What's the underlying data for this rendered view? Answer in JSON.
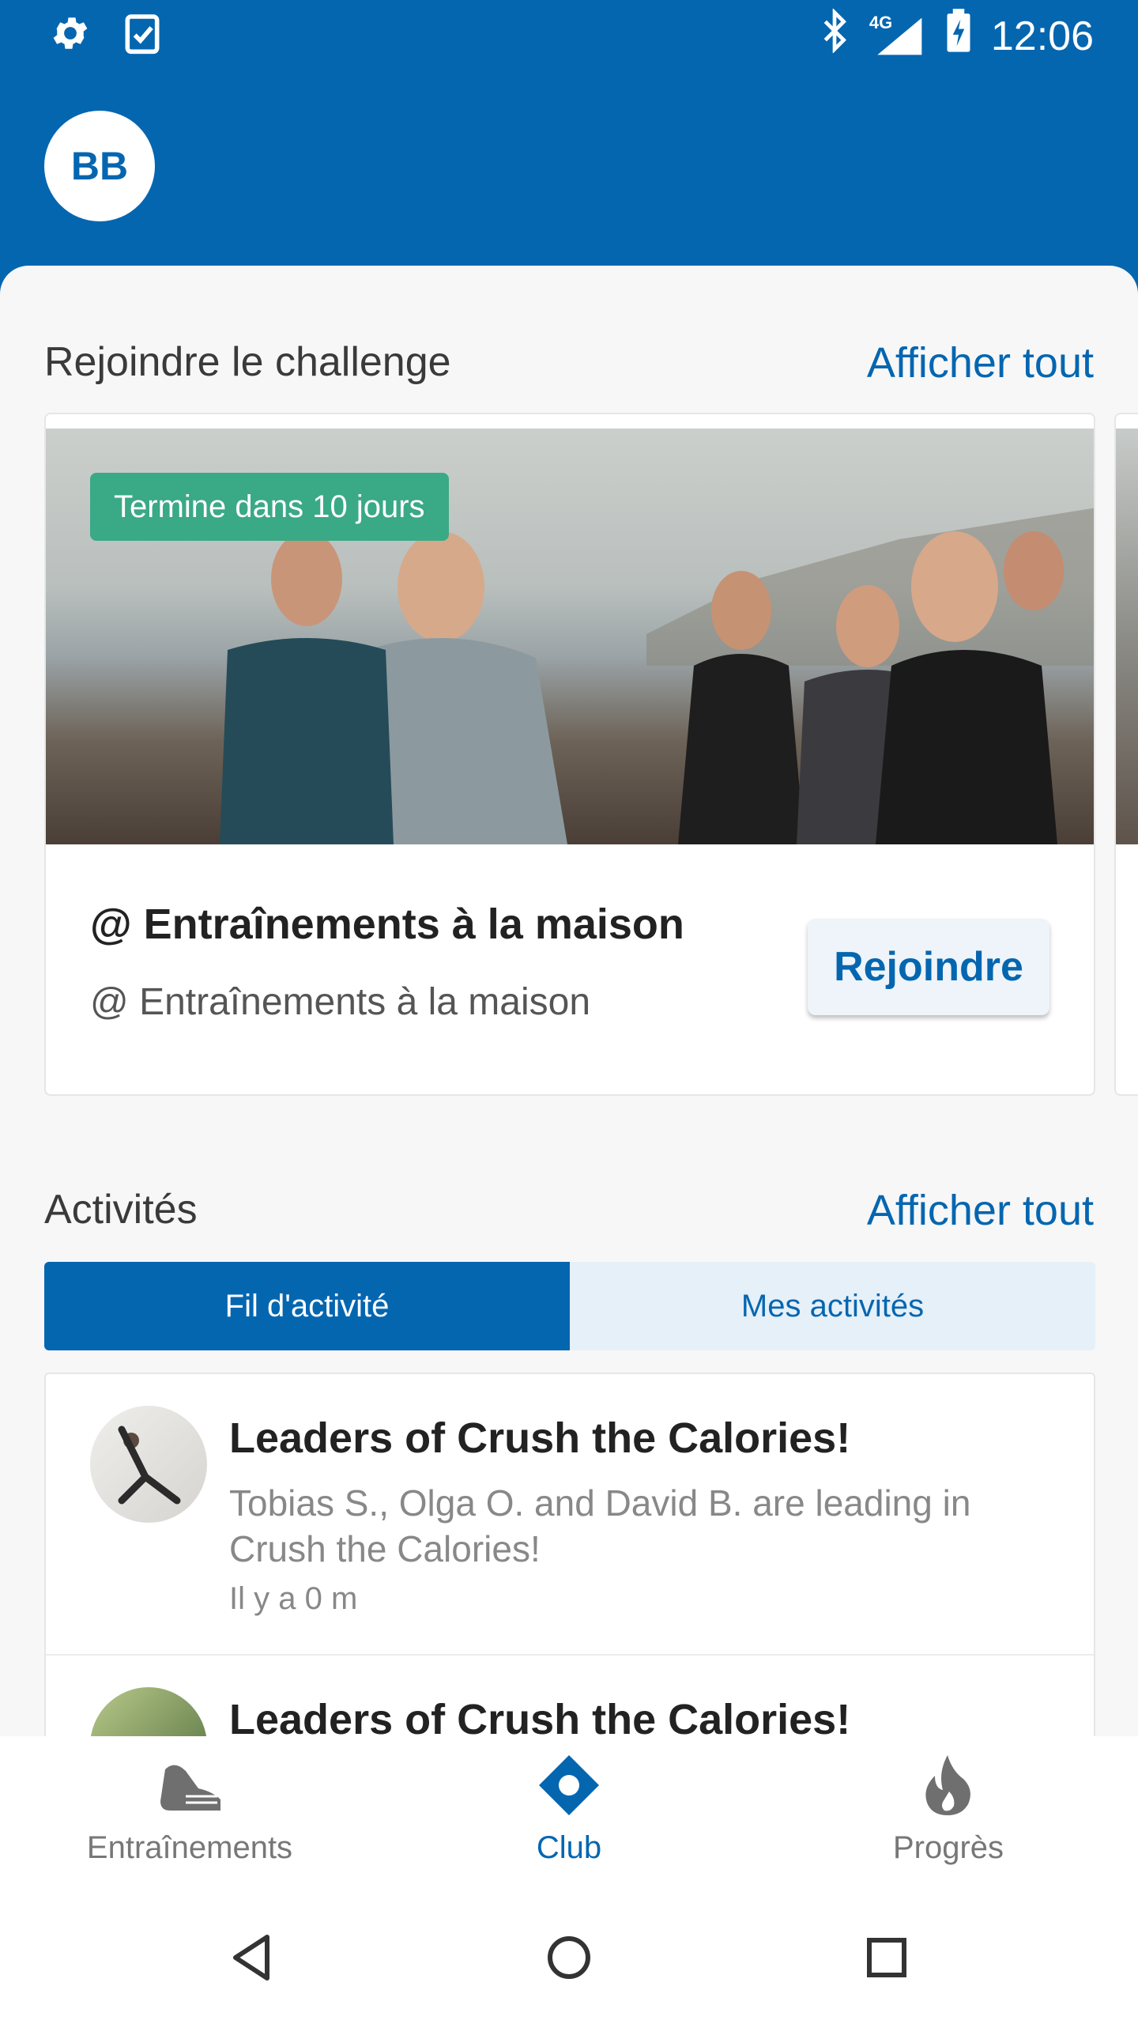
{
  "status_bar": {
    "time": "12:06",
    "network": "4G"
  },
  "header": {
    "avatar_initials": "BB"
  },
  "challenge_section": {
    "title": "Rejoindre le challenge",
    "see_all": "Afficher tout",
    "card": {
      "badge": "Termine dans 10 jours",
      "title": "@ Entraînements à la maison",
      "subtitle": "@ Entraînements à la maison",
      "join_label": "Rejoindre"
    }
  },
  "activities_section": {
    "title": "Activités",
    "see_all": "Afficher tout",
    "tabs": [
      {
        "label": "Fil d'activité",
        "active": true
      },
      {
        "label": "Mes activités",
        "active": false
      }
    ],
    "feed": [
      {
        "title": "Leaders of Crush the Calories!",
        "text": "Tobias S., Olga O. and David B. are leading in Crush the Calories!",
        "time": "Il y a 0 m"
      },
      {
        "title": "Leaders of Crush the Calories!"
      }
    ]
  },
  "bottom_nav": [
    {
      "label": "Entraînements",
      "icon": "shoe-icon",
      "active": false
    },
    {
      "label": "Club",
      "icon": "club-icon",
      "active": true
    },
    {
      "label": "Progrès",
      "icon": "flame-icon",
      "active": false
    }
  ],
  "colors": {
    "primary": "#0566b0",
    "badge_green": "#3aa985",
    "inactive": "#777777"
  }
}
